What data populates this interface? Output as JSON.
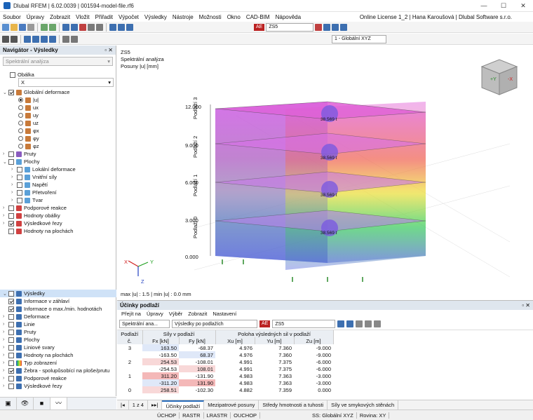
{
  "window": {
    "title": "Dlubal RFEM | 6.02.0039 | 001594-model-file.rf6"
  },
  "menu": [
    "Soubor",
    "Úpravy",
    "Zobrazit",
    "Vložit",
    "Přiřadit",
    "Výpočet",
    "Výsledky",
    "Nástroje",
    "Možnosti",
    "Okno",
    "CAD-BIM",
    "Nápověda"
  ],
  "license": "Online License 1_2 | Hana Karoušová | Dlubal Software s.r.o.",
  "toolbar": {
    "load_badge": "AE",
    "load_case": "ZS5",
    "coord_system": "1 - Globální XYZ"
  },
  "navigator": {
    "title": "Navigátor - Výsledky",
    "analysis": "Spektrální analýza",
    "envelope": "Obálka",
    "envelope_value": "X",
    "items": [
      "Globální deformace",
      "|u|",
      "ux",
      "uy",
      "uz",
      "φx",
      "φy",
      "φz",
      "Pruty",
      "Plochy",
      "Lokální deformace",
      "Vnitřní síly",
      "Napětí",
      "Přetvoření",
      "Tvar",
      "Podporové reakce",
      "Hodnoty obálky",
      "Výsledkové řezy",
      "Hodnoty na plochách"
    ],
    "lower": [
      "Výsledky",
      "Informace v záhlaví",
      "Informace o max./min. hodnotách",
      "Deformace",
      "Linie",
      "Pruty",
      "Plochy",
      "Liniové svary",
      "Hodnoty na plochách",
      "Typ zobrazení",
      "Žebra - spolupůsobící na ploše/prutu",
      "Podporové reakce",
      "Výsledkové řezy"
    ]
  },
  "view": {
    "case": "ZS5",
    "analysis": "Spektrální analýza",
    "quantity": "Posuny |u| [mm]",
    "levels": [
      "12.000",
      "9.000",
      "6.000",
      "3.000",
      "0.000"
    ],
    "floors": [
      "Podlaží 3",
      "Podlaží 2",
      "Podlaží 1",
      "Podlaží 0"
    ],
    "mass": "38.569 t",
    "maxmin": "max |u| : 1.5 | min |u| : 0.0 mm",
    "axis_x": "X",
    "axis_y": "Y",
    "axis_z": "Z",
    "cube_y": "+Y",
    "cube_x": "-X"
  },
  "panel": {
    "title": "Účinky podlaží",
    "menu": [
      "Přejít na",
      "Úpravy",
      "Výběr",
      "Zobrazit",
      "Nastavení"
    ],
    "analysis": "Spektrální ana...",
    "results": "Výsledky po podlažích",
    "badge": "AE",
    "case": "ZS5",
    "head": {
      "floor": "Podlaží",
      "no": "č.",
      "forces": "Síly v podlaží",
      "fx": "Fx [kN]",
      "fy": "Fy [kN]",
      "pos": "Poloha výsledných sil v podlaží",
      "xu": "Xu [m]",
      "yu": "Yu [m]",
      "zu": "Zu [m]"
    },
    "rows": [
      [
        "3",
        "163.50",
        "-68.37",
        "4.976",
        "7.360",
        "-9.000"
      ],
      [
        "",
        "-163.50",
        "68.37",
        "4.976",
        "7.360",
        "-9.000"
      ],
      [
        "2",
        "254.53",
        "-108.01",
        "4.991",
        "7.375",
        "-6.000"
      ],
      [
        "",
        "-254.53",
        "108.01",
        "4.991",
        "7.375",
        "-6.000"
      ],
      [
        "1",
        "311.20",
        "-131.90",
        "4.983",
        "7.363",
        "-3.000"
      ],
      [
        "",
        "-311.20",
        "131.90",
        "4.983",
        "7.363",
        "-3.000"
      ],
      [
        "0",
        "258.51",
        "-102.30",
        "4.882",
        "7.359",
        "0.000"
      ]
    ],
    "pager": "1 z 4",
    "tabs": [
      "Účinky podlaží",
      "Mezipatrové posuny",
      "Středy hmotnosti a tuhosti",
      "Síly ve smykových stěnách"
    ]
  },
  "status": [
    "ÚCHOP",
    "RASTR",
    "LRASTR",
    "OUCHOP",
    "SS: Globální XYZ",
    "Rovina: XY"
  ]
}
